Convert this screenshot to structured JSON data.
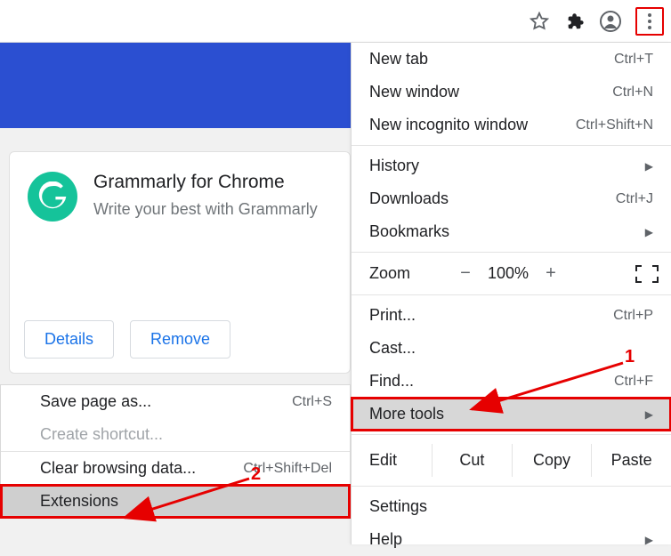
{
  "toolbar": {
    "star_icon": "star-icon",
    "ext_icon": "puzzle-icon",
    "profile_icon": "profile-icon",
    "kebab_icon": "kebab-menu-icon"
  },
  "card": {
    "title": "Grammarly for Chrome",
    "subtitle": "Write your best with Grammarly",
    "details_label": "Details",
    "remove_label": "Remove"
  },
  "menu": {
    "new_tab": "New tab",
    "new_tab_hint": "Ctrl+T",
    "new_window": "New window",
    "new_window_hint": "Ctrl+N",
    "new_incognito": "New incognito window",
    "new_incognito_hint": "Ctrl+Shift+N",
    "history": "History",
    "downloads": "Downloads",
    "downloads_hint": "Ctrl+J",
    "bookmarks": "Bookmarks",
    "zoom_label": "Zoom",
    "zoom_value": "100%",
    "print": "Print...",
    "print_hint": "Ctrl+P",
    "cast": "Cast...",
    "find": "Find...",
    "find_hint": "Ctrl+F",
    "more_tools": "More tools",
    "edit_label": "Edit",
    "cut": "Cut",
    "copy": "Copy",
    "paste": "Paste",
    "settings": "Settings",
    "help": "Help"
  },
  "submenu": {
    "save_page": "Save page as...",
    "save_page_hint": "Ctrl+S",
    "create_shortcut": "Create shortcut...",
    "clear_data": "Clear browsing data...",
    "clear_data_hint": "Ctrl+Shift+Del",
    "extensions": "Extensions"
  },
  "annotations": {
    "num1": "1",
    "num2": "2"
  }
}
